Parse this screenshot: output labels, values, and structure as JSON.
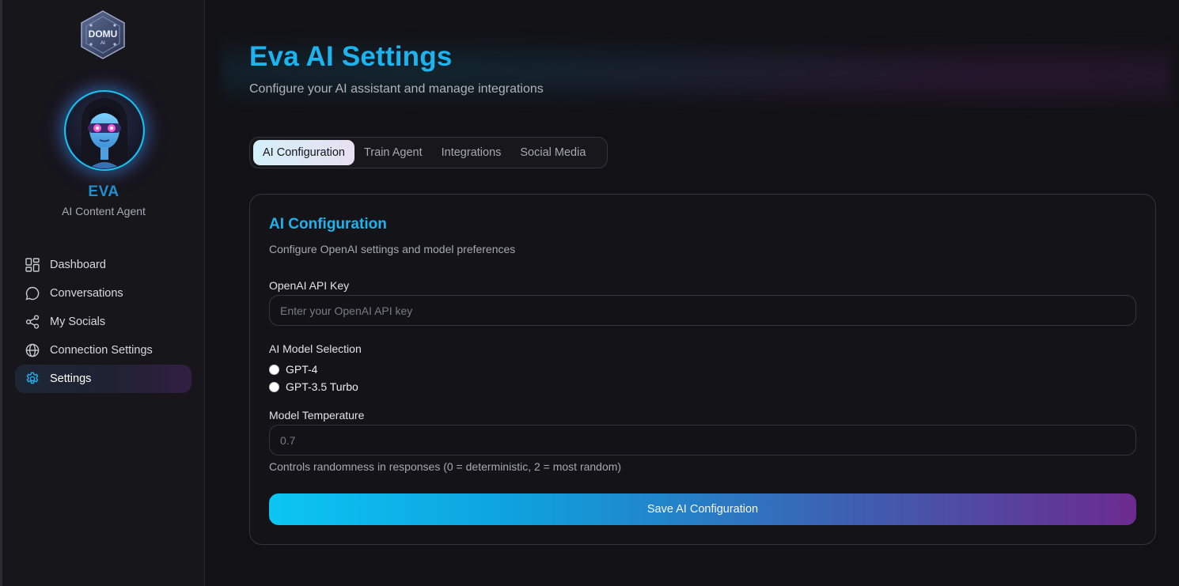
{
  "brand": {
    "logo_text": "DOMU",
    "logo_sub": "AI"
  },
  "agent": {
    "name": "EVA",
    "role": "AI Content Agent"
  },
  "sidebar": {
    "items": [
      {
        "label": "Dashboard",
        "icon": "dashboard-icon"
      },
      {
        "label": "Conversations",
        "icon": "chat-bubble-icon"
      },
      {
        "label": "My Socials",
        "icon": "share-icon"
      },
      {
        "label": "Connection Settings",
        "icon": "globe-icon"
      },
      {
        "label": "Settings",
        "icon": "gear-icon",
        "active": true
      }
    ]
  },
  "header": {
    "title": "Eva AI Settings",
    "subtitle": "Configure your AI assistant and manage integrations"
  },
  "tabs": [
    {
      "label": "AI Configuration",
      "active": true
    },
    {
      "label": "Train Agent"
    },
    {
      "label": "Integrations"
    },
    {
      "label": "Social Media"
    }
  ],
  "card": {
    "title": "AI Configuration",
    "description": "Configure OpenAI settings and model preferences",
    "api_key": {
      "label": "OpenAI API Key",
      "placeholder": "Enter your OpenAI API key",
      "value": ""
    },
    "model": {
      "label": "AI Model Selection",
      "options": [
        "GPT-4",
        "GPT-3.5 Turbo"
      ],
      "selected": null
    },
    "temperature": {
      "label": "Model Temperature",
      "placeholder": "0.7",
      "help": "Controls randomness in responses (0 = deterministic, 2 = most random)"
    },
    "save_label": "Save AI Configuration"
  },
  "colors": {
    "accent": "#1cb3ef",
    "agent_name": "#1f8fd1",
    "gradient_start": "#0bc5f3",
    "gradient_end": "#6c2a8e"
  }
}
